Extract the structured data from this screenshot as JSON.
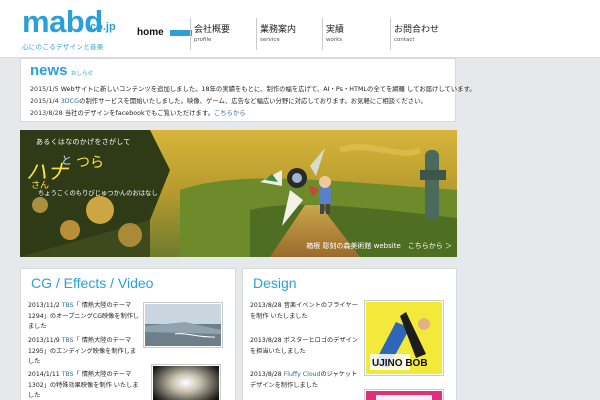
{
  "header": {
    "logo_main": "mabd",
    "logo_suffix": "co.jp",
    "logo_tagline": "心にのこるデザインと音楽",
    "nav": [
      {
        "label": "home",
        "sub": ""
      },
      {
        "label": "会社概要",
        "sub": "profile"
      },
      {
        "label": "業務案内",
        "sub": "service"
      },
      {
        "label": "実績",
        "sub": "works"
      },
      {
        "label": "お問合わせ",
        "sub": "contact"
      }
    ]
  },
  "news": {
    "title": "news",
    "subtitle": "おしらせ",
    "items": [
      {
        "date": "2015/1/5",
        "text": " Webサイトに新しいコンテンツを追加しました。18年の実績をもとに、制作の幅を広げて、AI・Ps・HTMLの全てを網羅 してお届けしています。",
        "link": ""
      },
      {
        "date": "2015/1/4",
        "text": " ",
        "link": "3DCG",
        "text2": "の制作サービスを開始いたしました。映像、ゲーム、広告など幅広い分野に対応しております。お気軽にご相談ください。"
      },
      {
        "date": "2013/8/28",
        "text": " 当社のデザインをfacebookでもご覧いただけます。",
        "link": "こちらから"
      }
    ]
  },
  "banner": {
    "line1": "あるくはなのかげをさがして",
    "title_hana": "ハナ",
    "title_to": "と",
    "title_san": "さん",
    "title_tsu": "つら",
    "line2": "ちょうこくのもりびじゅつかんのおはなし",
    "caption": "箱根 彫刻の森美術館 website　こちらから ＞"
  },
  "cg_panel": {
    "title": "CG / Effects / Video",
    "entries": [
      {
        "date": "2013/11/2",
        "link": "TBS",
        "text": "「 情熱大陸のテーマ1294」のオープニングCG映像を制作しました"
      },
      {
        "date": "2013/11/9",
        "link": "TBS",
        "text": "「 情熱大陸のテーマ1295」のエンディング映像を制作しました"
      },
      {
        "date": "2014/1/11",
        "link": "TBS",
        "text": "「 情熱大陸のテーマ1302」の特殊効果映像を制作 いたしました"
      }
    ]
  },
  "design_panel": {
    "title": "Design",
    "entries": [
      {
        "date": "2013/8/28",
        "link": "",
        "text": " 音楽イベントのフライヤーを制作 いたしました"
      },
      {
        "date": "2013/8/28",
        "link": "",
        "text": " ポスターとロゴのデザインを担当いたしました"
      },
      {
        "date": "2013/8/28",
        "link": "Fluffy Cloud",
        "text": "のジャケットデザインを制作しました"
      }
    ],
    "poster_text": "UJINO BOB"
  },
  "colors": {
    "accent": "#2ba0d8",
    "link": "#2b6ca8",
    "background": "#e6e9ec"
  }
}
